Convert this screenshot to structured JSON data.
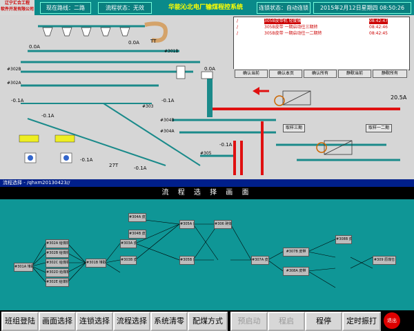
{
  "topbar": {
    "logo_line1": "辽宁汇合工程",
    "logo_line2": "软件开发有限公司",
    "route_label": "现在路线：二路",
    "process_status": "流程状态：无效",
    "system_title": "华能沁北电厂输煤程控系统",
    "linkage_status": "连锁状态：自动连锁",
    "datetime": "2015年2月12日星期四  08:50:26"
  },
  "alarms": [
    {
      "mark": "/",
      "text": "305B皮带机  轻度偏",
      "time": "08:42:47"
    },
    {
      "mark": "/",
      "text": "305B皮带 一期启动往三期转",
      "time": "08:42:46"
    },
    {
      "mark": "/",
      "text": "305B皮带 一期启动往一二期转",
      "time": "08:42:45"
    }
  ],
  "alarm_buttons": [
    "确认当前",
    "确认本页",
    "确认所有",
    "静默当前",
    "静默所有"
  ],
  "process": {
    "labels": [
      "#301B",
      "#302B",
      "#302A",
      "#303",
      "#304B",
      "#304A",
      "#305",
      "27T"
    ],
    "currents": [
      "0.0A",
      "0.0A",
      "-0.1A",
      "-0.1A",
      "-0.1A",
      "-0.1A",
      "-0.1A",
      "-0.1A",
      "20.5A",
      "0.0A"
    ],
    "mode_buttons": [
      "取样三期",
      "取样一二期"
    ],
    "tt_label": "TT"
  },
  "flow_window": {
    "titlebar": "流程选择 - /qhxm20130423//",
    "header": "流 程 选 择 画 面",
    "nodes": [
      "#301A 堆取料机",
      "#302A 给煤机",
      "#302B 给煤机",
      "#302C 给煤机",
      "#302D 给煤机",
      "#302E 给煤机",
      "#301B 堆取料机",
      "#303A 皮带",
      "#303B 皮带",
      "#304A 皮带",
      "#304B 皮带",
      "#305A 皮带",
      "#305B 皮带",
      "#306 碎煤机",
      "#307A 皮带",
      "#307B 皮带",
      "#308A 皮带",
      "#308B 皮带",
      "#309 原煤仓"
    ]
  },
  "bottom_buttons": [
    {
      "label": "班组登陆",
      "enabled": true
    },
    {
      "label": "画面选择",
      "enabled": true
    },
    {
      "label": "连锁选择",
      "enabled": true
    },
    {
      "label": "流程选择",
      "enabled": true
    },
    {
      "label": "系统清零",
      "enabled": true
    },
    {
      "label": "配煤方式",
      "enabled": true
    },
    {
      "label": "预启动",
      "enabled": false
    },
    {
      "label": "程启",
      "enabled": false
    },
    {
      "label": "程停",
      "enabled": true
    },
    {
      "label": "定时振打",
      "enabled": true
    }
  ],
  "exit_label": "退出",
  "colors": {
    "teal": "#0f9696",
    "belt_red": "#e01010",
    "pipe_teal": "#1a8a8a",
    "title_blue": "#001f8a"
  }
}
